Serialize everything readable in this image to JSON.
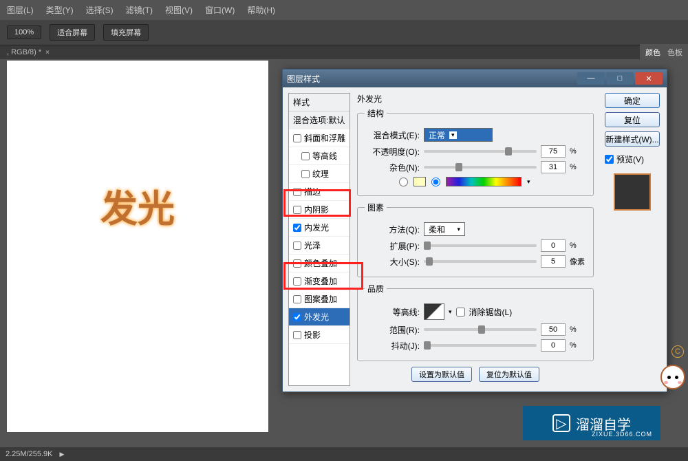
{
  "menu": [
    "图层(L)",
    "类型(Y)",
    "选择(S)",
    "滤镜(T)",
    "视图(V)",
    "窗口(W)",
    "帮助(H)"
  ],
  "toolbar": {
    "zoom": "100%",
    "fit_screen": "适合屏幕",
    "fill_screen": "填充屏幕"
  },
  "tab": ", RGB/8) *",
  "canvas_text": "发光",
  "panel_tabs": {
    "color": "颜色",
    "swatch": "色板"
  },
  "dialog": {
    "title": "图层样式",
    "styles_header": "样式",
    "blend_default": "混合选项:默认",
    "items": [
      {
        "label": "斜面和浮雕",
        "checked": false
      },
      {
        "label": "等高线",
        "checked": false,
        "indent": true
      },
      {
        "label": "纹理",
        "checked": false,
        "indent": true
      },
      {
        "label": "描边",
        "checked": false
      },
      {
        "label": "内阴影",
        "checked": false
      },
      {
        "label": "内发光",
        "checked": true
      },
      {
        "label": "光泽",
        "checked": false
      },
      {
        "label": "颜色叠加",
        "checked": false
      },
      {
        "label": "渐变叠加",
        "checked": false
      },
      {
        "label": "图案叠加",
        "checked": false
      },
      {
        "label": "外发光",
        "checked": true,
        "selected": true
      },
      {
        "label": "投影",
        "checked": false
      }
    ],
    "section_title": "外发光",
    "structure_legend": "结构",
    "blend_mode_label": "混合模式(E):",
    "blend_mode_value": "正常",
    "opacity_label": "不透明度(O):",
    "opacity_value": "75",
    "noise_label": "杂色(N):",
    "noise_value": "31",
    "percent": "%",
    "elements_legend": "图素",
    "method_label": "方法(Q):",
    "method_value": "柔和",
    "spread_label": "扩展(P):",
    "spread_value": "0",
    "size_label": "大小(S):",
    "size_value": "5",
    "px": "像素",
    "quality_legend": "品质",
    "contour_label": "等高线:",
    "antialias_label": "消除锯齿(L)",
    "range_label": "范围(R):",
    "range_value": "50",
    "jitter_label": "抖动(J):",
    "jitter_value": "0",
    "reset_default": "设置为默认值",
    "restore_default": "复位为默认值",
    "ok": "确定",
    "cancel": "复位",
    "new_style": "新建样式(W)...",
    "preview": "预览(V)"
  },
  "status": "2.25M/255.9K",
  "watermark": {
    "text": "溜溜自学",
    "sub": "ZIXUE.3D66.COM"
  }
}
